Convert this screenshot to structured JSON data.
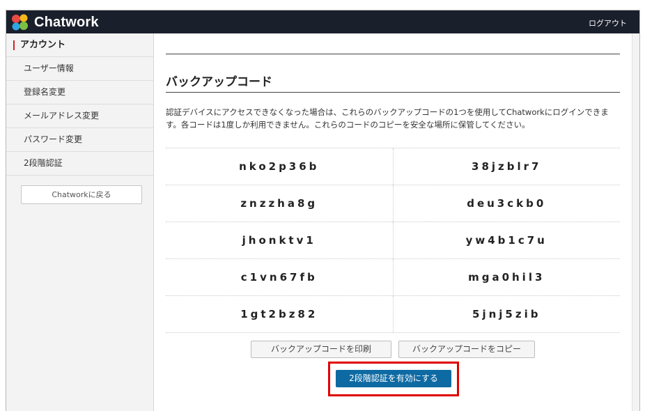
{
  "header": {
    "app_name": "Chatwork",
    "logout_label": "ログアウト",
    "background_color": "#1a1f2c"
  },
  "sidebar": {
    "heading": "アカウント",
    "items": [
      {
        "label": "ユーザー情報"
      },
      {
        "label": "登録名変更"
      },
      {
        "label": "メールアドレス変更"
      },
      {
        "label": "パスワード変更"
      },
      {
        "label": "2段階認証"
      }
    ],
    "back_button_label": "Chatworkに戻る"
  },
  "main": {
    "title": "バックアップコード",
    "description": "認証デバイスにアクセスできなくなった場合は、これらのバックアップコードの1つを使用してChatworkにログインできます。各コードは1度しか利用できません。これらのコードのコピーを安全な場所に保管してください。",
    "codes": [
      [
        "nko2p36b",
        "38jzblr7"
      ],
      [
        "znzzha8g",
        "deu3ckb0"
      ],
      [
        "jhonktv1",
        "yw4b1c7u"
      ],
      [
        "c1vn67fb",
        "mga0hil3"
      ],
      [
        "1gt2bz82",
        "5jnj5zib"
      ]
    ],
    "print_button_label": "バックアップコードを印刷",
    "copy_button_label": "バックアップコードをコピー",
    "enable_button_label": "2段階認証を有効にする",
    "accent_color": "#0e6aa3",
    "highlight_color": "#e00000"
  }
}
